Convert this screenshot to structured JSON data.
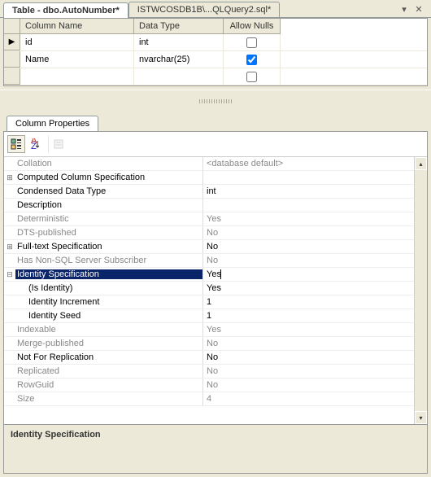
{
  "tabs": {
    "active": "Table - dbo.AutoNumber*",
    "other": "ISTWCOSDB1B\\...QLQuery2.sql*"
  },
  "tableDesigner": {
    "headers": {
      "colname": "Column Name",
      "dtype": "Data Type",
      "nulls": "Allow Nulls"
    },
    "rows": [
      {
        "name": "id",
        "dtype": "int",
        "nulls": false,
        "indicator": "▶"
      },
      {
        "name": "Name",
        "dtype": "nvarchar(25)",
        "nulls": true,
        "indicator": ""
      },
      {
        "name": "",
        "dtype": "",
        "nulls": false,
        "indicator": ""
      }
    ]
  },
  "propsTabLabel": "Column Properties",
  "props": [
    {
      "name": "Collation",
      "value": "<database default>",
      "disabled": true,
      "exp": ""
    },
    {
      "name": "Computed Column Specification",
      "value": "",
      "disabled": false,
      "exp": "+"
    },
    {
      "name": "Condensed Data Type",
      "value": "int",
      "disabled": false,
      "exp": ""
    },
    {
      "name": "Description",
      "value": "",
      "disabled": false,
      "exp": ""
    },
    {
      "name": "Deterministic",
      "value": "Yes",
      "disabled": true,
      "exp": ""
    },
    {
      "name": "DTS-published",
      "value": "No",
      "disabled": true,
      "exp": ""
    },
    {
      "name": "Full-text Specification",
      "value": "No",
      "disabled": false,
      "exp": "+"
    },
    {
      "name": "Has Non-SQL Server Subscriber",
      "value": "No",
      "disabled": true,
      "exp": ""
    },
    {
      "name": "Identity Specification",
      "value": "Yes",
      "disabled": false,
      "exp": "−",
      "selected": true
    },
    {
      "name": "(Is Identity)",
      "value": "Yes",
      "disabled": false,
      "exp": "",
      "indent": 1
    },
    {
      "name": "Identity Increment",
      "value": "1",
      "disabled": false,
      "exp": "",
      "indent": 1
    },
    {
      "name": "Identity Seed",
      "value": "1",
      "disabled": false,
      "exp": "",
      "indent": 1
    },
    {
      "name": "Indexable",
      "value": "Yes",
      "disabled": true,
      "exp": ""
    },
    {
      "name": "Merge-published",
      "value": "No",
      "disabled": true,
      "exp": ""
    },
    {
      "name": "Not For Replication",
      "value": "No",
      "disabled": false,
      "exp": ""
    },
    {
      "name": "Replicated",
      "value": "No",
      "disabled": true,
      "exp": ""
    },
    {
      "name": "RowGuid",
      "value": "No",
      "disabled": true,
      "exp": ""
    },
    {
      "name": "Size",
      "value": "4",
      "disabled": true,
      "exp": ""
    }
  ],
  "descTitle": "Identity Specification"
}
